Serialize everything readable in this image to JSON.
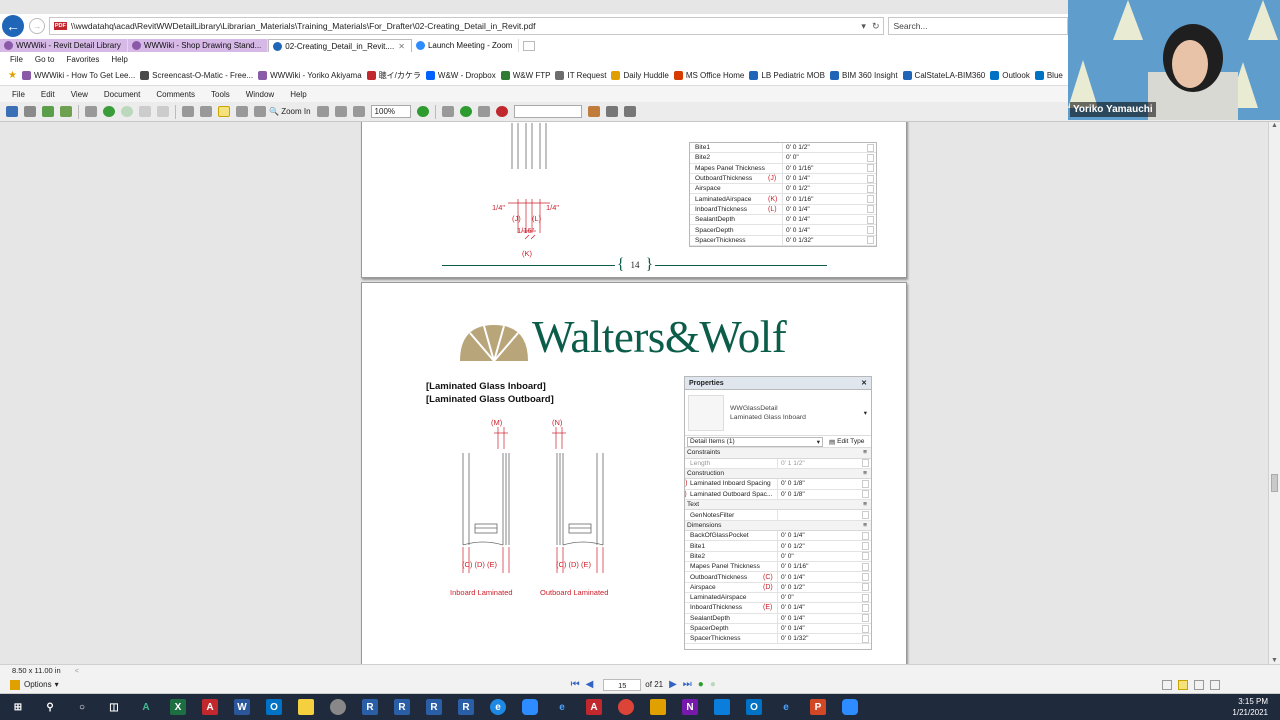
{
  "browser": {
    "url": "\\\\wwdatahq\\acad\\RevitWWDetailLibrary\\Librarian_Materials\\Training_Materials\\For_Drafter\\02-Creating_Detail_in_Revit.pdf",
    "search_placeholder": "Search...",
    "tabs": [
      {
        "label": "WWWiki - Revit Detail Library",
        "style": "purple"
      },
      {
        "label": "WWWiki - Shop Drawing Stand...",
        "style": "purple"
      },
      {
        "label": "02-Creating_Detail_in_Revit....",
        "style": "active"
      },
      {
        "label": "Launch Meeting - Zoom",
        "style": "normal"
      }
    ],
    "menu": [
      "File",
      "Go to",
      "Favorites",
      "Help"
    ],
    "favorites": [
      "WWWiki - How To Get Lee...",
      "Screencast-O-Matic - Free...",
      "WWWiki - Yoriko Akiyama",
      "聴イ/カケラ",
      "W&W - Dropbox",
      "W&W FTP",
      "IT Request",
      "Daily Huddle",
      "MS Office Home",
      "LB Pediatric MOB",
      "BIM 360 Insight",
      "CalStateLA-BIM360",
      "Outlook",
      "Blue"
    ]
  },
  "acrobat": {
    "menu": [
      "File",
      "Edit",
      "View",
      "Document",
      "Comments",
      "Tools",
      "Window",
      "Help"
    ],
    "zoom_label": "Zoom In",
    "zoom_value": "100%",
    "page_size": "8.50 x 11.00 in",
    "options_label": "Options",
    "current_page": "15",
    "total_pages": "of 21"
  },
  "page14": {
    "page_number": "14",
    "dims": {
      "left": "1/4\"",
      "right": "1/4\"",
      "center": "1/16\"",
      "j": "(J)",
      "l": "(L)",
      "k": "(K)"
    },
    "props": [
      {
        "name": "Bite1",
        "value": "0' 0 1/2\"",
        "ann": ""
      },
      {
        "name": "Bite2",
        "value": "0' 0\"",
        "ann": ""
      },
      {
        "name": "Mapes Panel Thickness",
        "value": "0' 0 1/16\"",
        "ann": ""
      },
      {
        "name": "OutboardThickness",
        "value": "0' 0 1/4\"",
        "ann": "(J)"
      },
      {
        "name": "Airspace",
        "value": "0' 0 1/2\"",
        "ann": ""
      },
      {
        "name": "LaminatedAirspace",
        "value": "0' 0 1/16\"",
        "ann": "(K)"
      },
      {
        "name": "InboardThickness",
        "value": "0' 0 1/4\"",
        "ann": "(L)"
      },
      {
        "name": "SealantDepth",
        "value": "0' 0 1/4\"",
        "ann": ""
      },
      {
        "name": "SpacerDepth",
        "value": "0' 0 1/4\"",
        "ann": ""
      },
      {
        "name": "SpacerThickness",
        "value": "0' 0 1/32\"",
        "ann": ""
      }
    ]
  },
  "page15": {
    "logo": "Walters&Wolf",
    "caption1": "[Laminated Glass Inboard]",
    "caption2": "[Laminated Glass Outboard]",
    "fig1_label": "Inboard Laminated",
    "fig2_label": "Outboard Laminated",
    "fig1_top": "(M)",
    "fig2_top": "(N)",
    "fig_bottom": "(C)  (D)  (E)",
    "props_title": "Properties",
    "type_family": "WWGlassDetail",
    "type_name": "Laminated Glass Inboard",
    "instance_filter": "Detail Items (1)",
    "edit_type": "Edit Type",
    "groups": [
      {
        "section": "Constraints",
        "rows": [
          {
            "name": "Length",
            "value": "0' 1 1/2\"",
            "ann": "",
            "dim": true
          }
        ]
      },
      {
        "section": "Construction",
        "rows": [
          {
            "name": "Laminated Inboard Spacing",
            "value": "0' 0 1/8\"",
            "ann": "(M)"
          },
          {
            "name": "Laminated Outboard Spac...",
            "value": "0' 0 1/8\"",
            "ann": "(N)"
          }
        ]
      },
      {
        "section": "Text",
        "rows": [
          {
            "name": "GenNotesFilter",
            "value": "",
            "ann": ""
          }
        ]
      },
      {
        "section": "Dimensions",
        "rows": [
          {
            "name": "BackOfGlassPocket",
            "value": "0' 0 1/4\"",
            "ann": ""
          },
          {
            "name": "Bite1",
            "value": "0' 0 1/2\"",
            "ann": ""
          },
          {
            "name": "Bite2",
            "value": "0' 0\"",
            "ann": ""
          },
          {
            "name": "Mapes Panel Thickness",
            "value": "0' 0 1/16\"",
            "ann": ""
          },
          {
            "name": "OutboardThickness",
            "value": "0' 0 1/4\"",
            "ann": "(C)"
          },
          {
            "name": "Airspace",
            "value": "0' 0 1/2\"",
            "ann": "(D)"
          },
          {
            "name": "LaminatedAirspace",
            "value": "0' 0\"",
            "ann": ""
          },
          {
            "name": "InboardThickness",
            "value": "0' 0 1/4\"",
            "ann": "(E)"
          },
          {
            "name": "SealantDepth",
            "value": "0' 0 1/4\"",
            "ann": ""
          },
          {
            "name": "SpacerDepth",
            "value": "0' 0 1/4\"",
            "ann": ""
          },
          {
            "name": "SpacerThickness",
            "value": "0' 0 1/32\"",
            "ann": ""
          }
        ]
      }
    ]
  },
  "webcam": {
    "name": "Yoriko Yamauchi"
  },
  "taskbar": {
    "time": "3:15 PM",
    "date": "1/21/2021"
  },
  "colors": {
    "annotation_red": "#cc1f2a",
    "logo_green": "#0b5d4a",
    "logo_gold": "#b9a57a",
    "accent_blue": "#1f66b8"
  }
}
